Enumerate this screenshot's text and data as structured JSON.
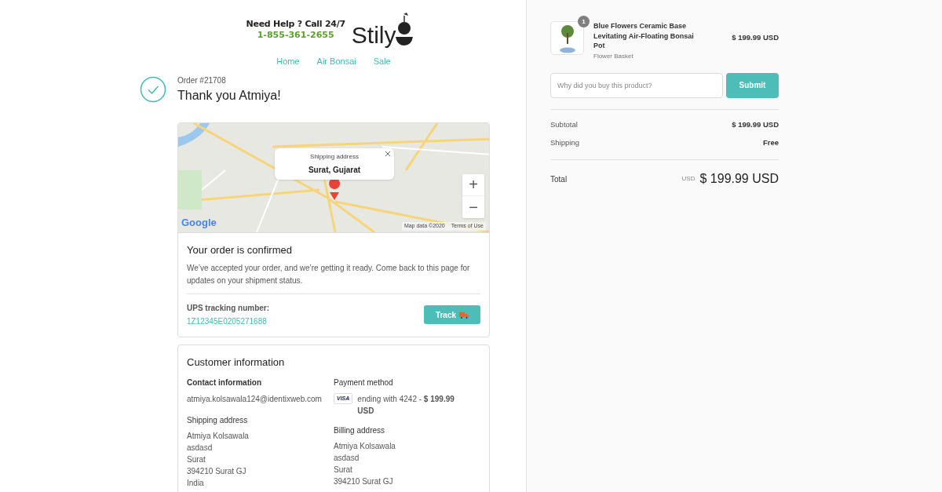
{
  "header": {
    "help_text": "Need Help ? Call 24/7",
    "phone": "1-855-361-2655",
    "logo": "Stily"
  },
  "nav": [
    {
      "label": "Home"
    },
    {
      "label": "Air Bonsai"
    },
    {
      "label": "Sale"
    }
  ],
  "order": {
    "number": "Order #21708",
    "greeting": "Thank you Atmiya!"
  },
  "map": {
    "popup_title": "Shipping address",
    "popup_place": "Surat, Gujarat",
    "zoom_in": "+",
    "zoom_out": "−",
    "brand": "Google",
    "map_data": "Map data ©2020",
    "terms": "Terms of Use"
  },
  "confirmation": {
    "title": "Your order is confirmed",
    "message": "We’ve accepted your order, and we’re getting it ready. Come back to this page for updates on your shipment status.",
    "tracking_label": "UPS tracking number:",
    "tracking_number": "1Z12345E0205271688",
    "track_button": "Track"
  },
  "customer": {
    "title": "Customer information",
    "contact_label": "Contact information",
    "email": "atmiya.kolsawala124@identixweb.com",
    "payment_label": "Payment method",
    "card_brand": "VISA",
    "payment_text": "ending with 4242 - **$ 199.99 USD**",
    "shipping_label": "Shipping address",
    "shipping_lines": [
      "Atmiya Kolsawala",
      "asdasd",
      "Surat",
      "394210 Surat GJ",
      "India"
    ],
    "billing_label": "Billing address",
    "billing_lines": [
      "Atmiya Kolsawala",
      "asdasd",
      "Surat",
      "394210 Surat GJ"
    ]
  },
  "cart": {
    "items": [
      {
        "quantity": "1",
        "name": "Blue Flowers Ceramic Base Levitating Air-Floating Bonsai Pot",
        "variant": "Flower Basket",
        "price": "$ 199.99 USD"
      }
    ],
    "feedback": {
      "placeholder": "Why did you buy this product?",
      "button": "Submit"
    },
    "subtotal_label": "Subtotal",
    "subtotal": "$ 199.99 USD",
    "shipping_label": "Shipping",
    "shipping": "Free",
    "total_label": "Total",
    "total_currency": "USD",
    "total": "$ 199.99 USD"
  }
}
